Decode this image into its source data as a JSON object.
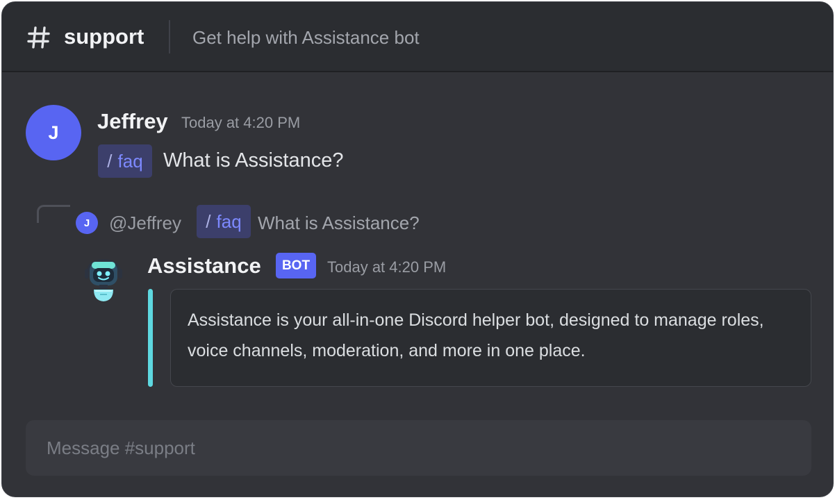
{
  "header": {
    "channel_name": "support",
    "topic": "Get help with Assistance bot",
    "icon": "hash-icon"
  },
  "message": {
    "avatar_letter": "J",
    "username": "Jeffrey",
    "timestamp": "Today at 4:20 PM",
    "command_slash": "/",
    "command_name": "faq",
    "text": "What is Assistance?"
  },
  "reply": {
    "avatar_letter": "J",
    "mention": "@Jeffrey",
    "command_slash": "/",
    "command_name": "faq",
    "text": "What is Assistance?"
  },
  "bot_message": {
    "avatar_icon": "robot-icon",
    "name": "Assistance",
    "badge": "BOT",
    "timestamp": "Today at 4:20 PM",
    "embed_text": "Assistance is your all-in-one Discord helper bot, designed to manage roles, voice channels, moderation, and more in one place.",
    "embed_color": "#5ed8e0"
  },
  "composer": {
    "placeholder": "Message #support"
  },
  "colors": {
    "accent": "#5865f2",
    "background": "#323338",
    "header_background": "#2b2d31"
  }
}
